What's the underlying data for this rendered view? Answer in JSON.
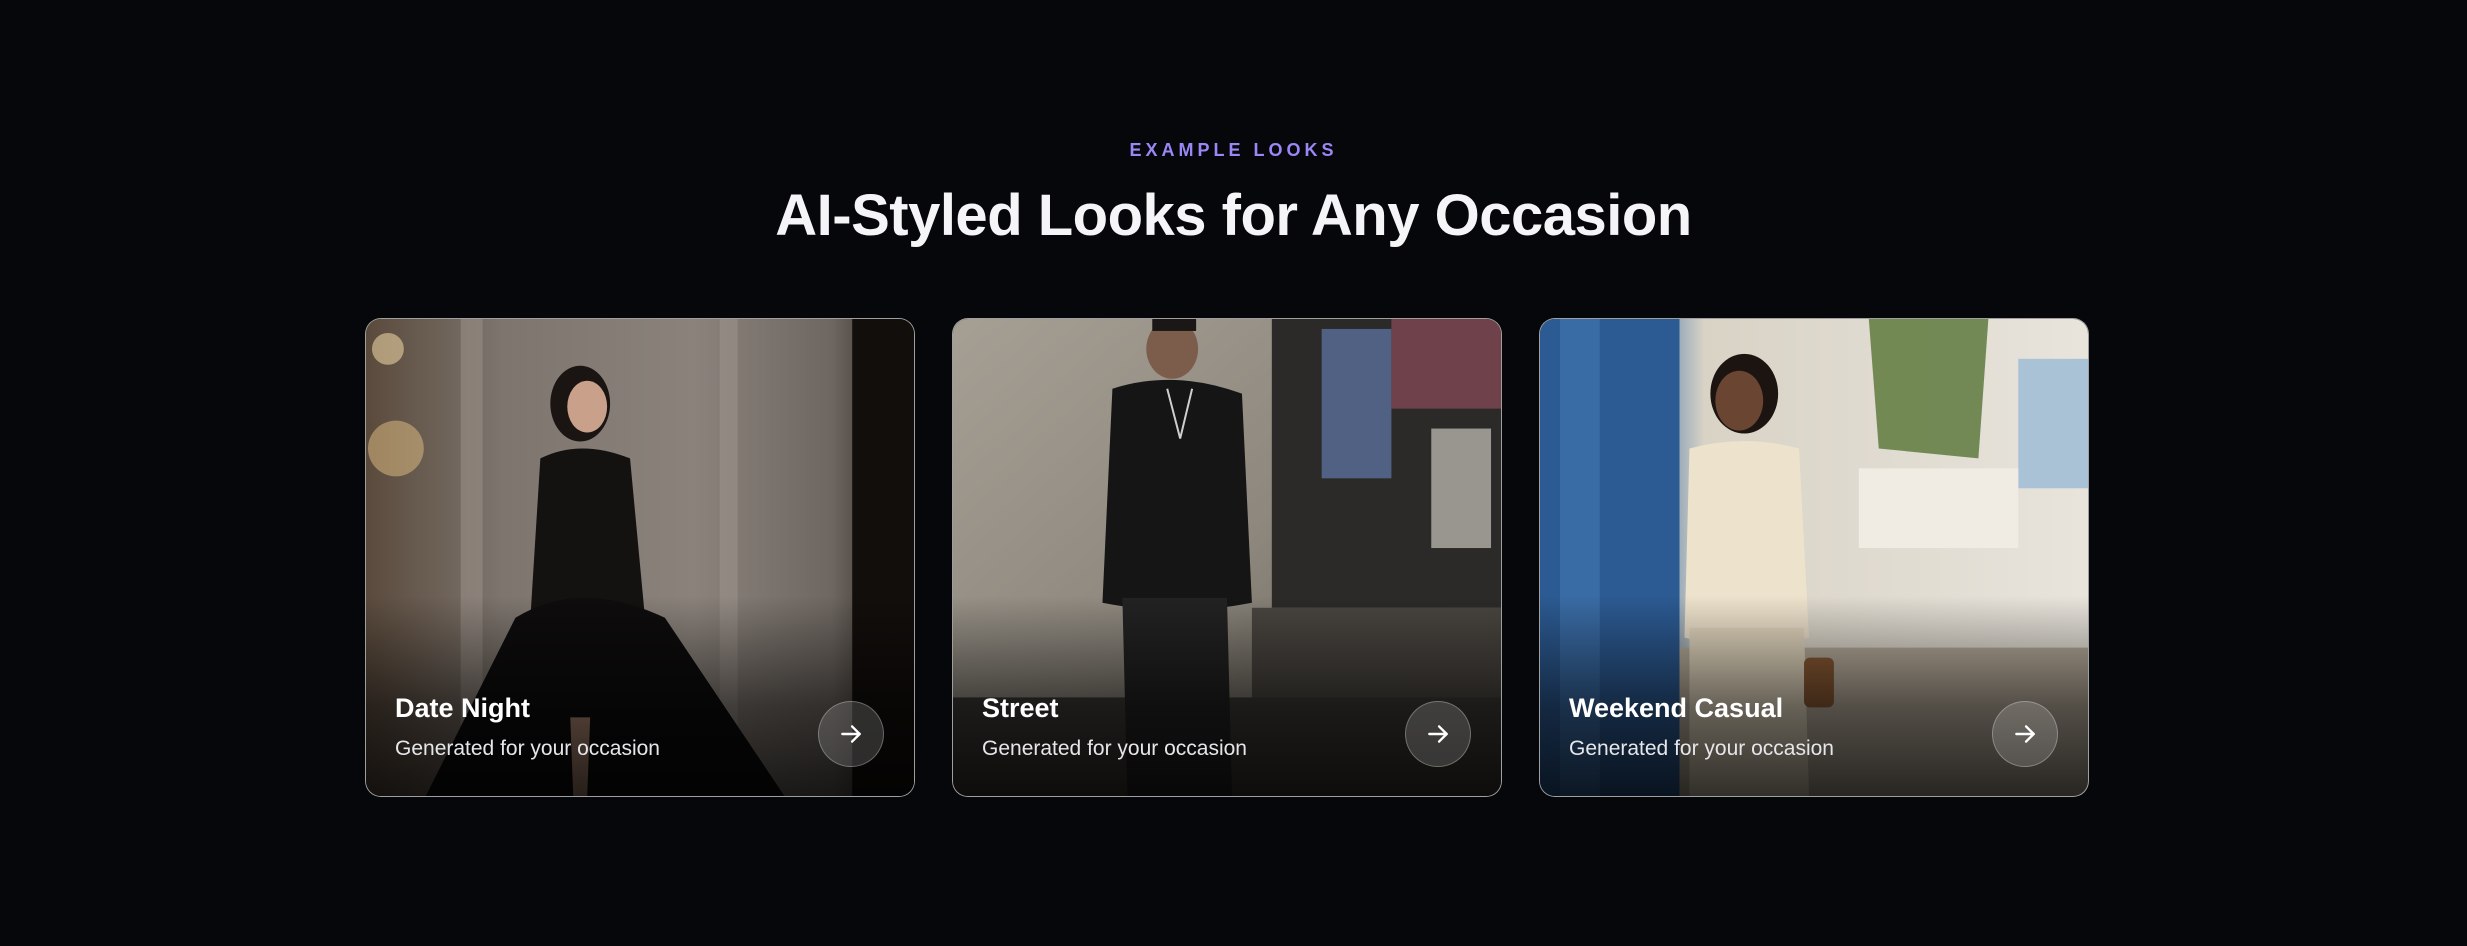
{
  "section": {
    "eyebrow": "EXAMPLE LOOKS",
    "title": "AI-Styled Looks for Any Occasion"
  },
  "colors": {
    "background": "#06070b",
    "accent": "#9b86f5"
  },
  "cards": [
    {
      "title": "Date Night",
      "subtitle": "Generated for your occasion",
      "icon": "arrow-right-icon"
    },
    {
      "title": "Street",
      "subtitle": "Generated for your occasion",
      "icon": "arrow-right-icon"
    },
    {
      "title": "Weekend Casual",
      "subtitle": "Generated for your occasion",
      "icon": "arrow-right-icon"
    }
  ]
}
